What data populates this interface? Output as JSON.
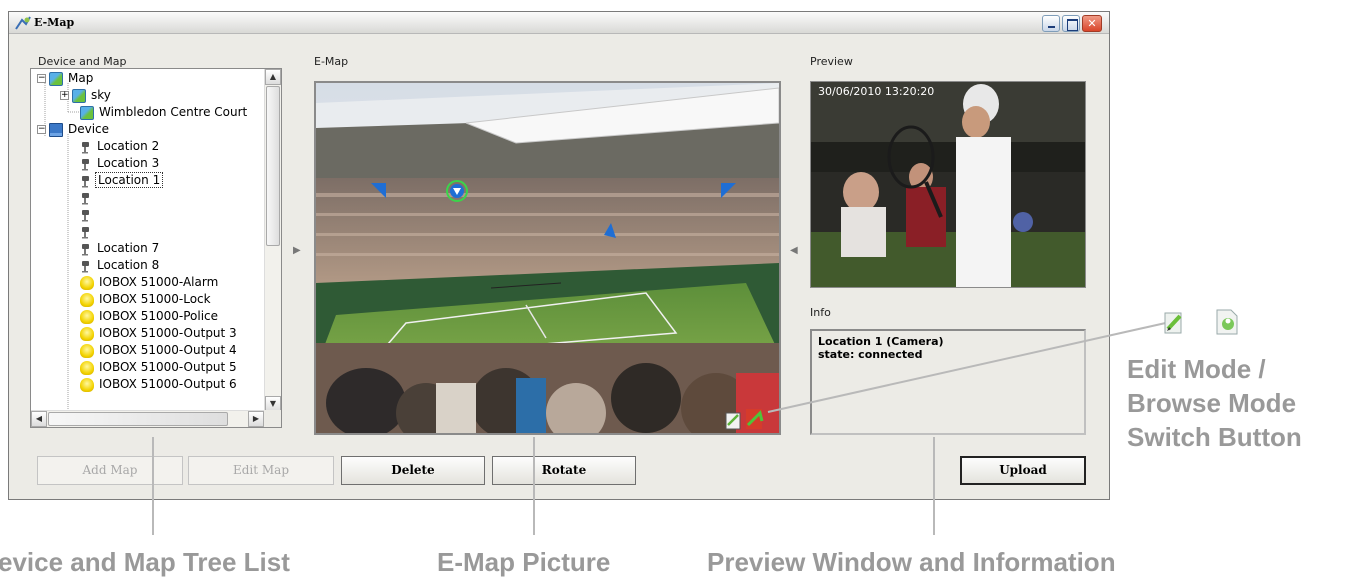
{
  "window": {
    "title": "E-Map"
  },
  "labels": {
    "device_and_map": "Device and Map",
    "emap": "E-Map",
    "preview": "Preview",
    "info": "Info"
  },
  "tree": {
    "rows": [
      {
        "label": "Map",
        "icon": "map-icon",
        "expander": "−",
        "selected": false
      },
      {
        "label": "sky",
        "icon": "map-icon",
        "expander": "+",
        "selected": false
      },
      {
        "label": "Wimbledon Centre Court",
        "icon": "map-icon",
        "expander": "",
        "selected": false
      },
      {
        "label": "Device",
        "icon": "device-icon",
        "expander": "−",
        "selected": false
      },
      {
        "label": "Location 2",
        "icon": "camera-icon",
        "expander": "",
        "selected": false
      },
      {
        "label": "Location 3",
        "icon": "camera-icon",
        "expander": "",
        "selected": false
      },
      {
        "label": "Location 1",
        "icon": "camera-icon",
        "expander": "",
        "selected": true
      },
      {
        "label": "",
        "icon": "camera-icon",
        "expander": "",
        "selected": false
      },
      {
        "label": "",
        "icon": "camera-icon",
        "expander": "",
        "selected": false
      },
      {
        "label": "",
        "icon": "camera-icon",
        "expander": "",
        "selected": false
      },
      {
        "label": "Location 7",
        "icon": "camera-icon",
        "expander": "",
        "selected": false
      },
      {
        "label": "Location 8",
        "icon": "camera-icon",
        "expander": "",
        "selected": false
      },
      {
        "label": "IOBOX 51000-Alarm",
        "icon": "bulb-icon",
        "expander": "",
        "selected": false
      },
      {
        "label": "IOBOX 51000-Lock",
        "icon": "bulb-icon",
        "expander": "",
        "selected": false
      },
      {
        "label": "IOBOX 51000-Police",
        "icon": "bulb-icon",
        "expander": "",
        "selected": false
      },
      {
        "label": "IOBOX 51000-Output 3",
        "icon": "bulb-icon",
        "expander": "",
        "selected": false
      },
      {
        "label": "IOBOX 51000-Output 4",
        "icon": "bulb-icon",
        "expander": "",
        "selected": false
      },
      {
        "label": "IOBOX 51000-Output 5",
        "icon": "bulb-icon",
        "expander": "",
        "selected": false
      },
      {
        "label": "IOBOX 51000-Output 6",
        "icon": "bulb-icon",
        "expander": "",
        "selected": false
      }
    ]
  },
  "preview": {
    "timestamp": "30/06/2010   13:20:20"
  },
  "info": {
    "line1": "Location 1 (Camera)",
    "line2": "state: connected"
  },
  "buttons": {
    "add_map": "Add Map",
    "edit_map": "Edit Map",
    "delete": "Delete",
    "rotate": "Rotate",
    "upload": "Upload"
  },
  "callouts": {
    "mode_switch_1": "Edit Mode /",
    "mode_switch_2": "Browse Mode",
    "mode_switch_3": "Switch Button",
    "tree_list": "evice and Map Tree List",
    "emap_picture": "E-Map Picture",
    "preview_info": "Preview Window and Information"
  },
  "colors": {
    "callout_text": "#999999",
    "window_bg": "#ecebe6",
    "close_button": "#d9452a"
  }
}
